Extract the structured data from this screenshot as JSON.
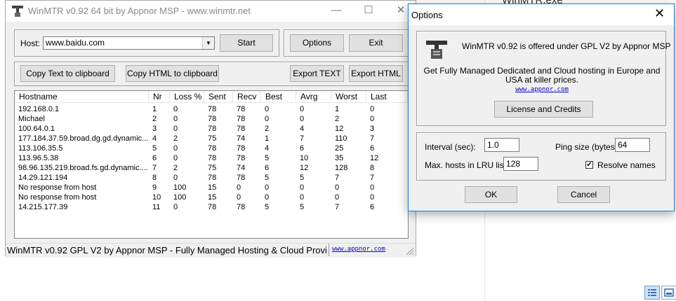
{
  "background_doc": {
    "title": "WinMTR.exe"
  },
  "main_window": {
    "title": "WinMTR v0.92 64 bit by Appnor MSP - www.winmtr.net",
    "controls": {
      "minimize": "—",
      "maximize": "☐",
      "close": "✕"
    },
    "host_label": "Host:",
    "host_value": "www.baidu.com",
    "start_label": "Start",
    "options_label": "Options",
    "exit_label": "Exit",
    "copy_text_label": "Copy Text to clipboard",
    "copy_html_label": "Copy HTML to clipboard",
    "export_text_label": "Export TEXT",
    "export_html_label": "Export HTML",
    "columns": [
      "Hostname",
      "Nr",
      "Loss %",
      "Sent",
      "Recv",
      "Best",
      "Avrg",
      "Worst",
      "Last"
    ],
    "rows": [
      [
        "192.168.0.1",
        "1",
        "0",
        "78",
        "78",
        "0",
        "0",
        "1",
        "0"
      ],
      [
        "Michael",
        "2",
        "0",
        "78",
        "78",
        "0",
        "0",
        "2",
        "0"
      ],
      [
        "100.64.0.1",
        "3",
        "0",
        "78",
        "78",
        "2",
        "4",
        "12",
        "3"
      ],
      [
        "177.184.37.59.broad.dg.gd.dynamic....",
        "4",
        "2",
        "75",
        "74",
        "1",
        "7",
        "110",
        "7"
      ],
      [
        "113.106.35.5",
        "5",
        "0",
        "78",
        "78",
        "4",
        "6",
        "25",
        "6"
      ],
      [
        "113.96.5.38",
        "6",
        "0",
        "78",
        "78",
        "5",
        "10",
        "35",
        "12"
      ],
      [
        "98.96.135.219.broad.fs.gd.dynamic....",
        "7",
        "2",
        "75",
        "74",
        "6",
        "12",
        "128",
        "8"
      ],
      [
        "14.29.121.194",
        "8",
        "0",
        "78",
        "78",
        "5",
        "5",
        "7",
        "7"
      ],
      [
        "No response from host",
        "9",
        "100",
        "15",
        "0",
        "0",
        "0",
        "0",
        "0"
      ],
      [
        "No response from host",
        "10",
        "100",
        "15",
        "0",
        "0",
        "0",
        "0",
        "0"
      ],
      [
        "14.215.177.39",
        "11",
        "0",
        "78",
        "78",
        "5",
        "5",
        "7",
        "6"
      ]
    ],
    "status_text": "WinMTR v0.92 GPL V2 by Appnor MSP - Fully Managed Hosting & Cloud Provi",
    "status_link": "www.appnor.com"
  },
  "options_dialog": {
    "title": "Options",
    "close": "✕",
    "about_line1": "WinMTR v0.92 is offered under GPL V2 by Appnor MSP",
    "about_line2": "Get Fully Managed Dedicated and Cloud hosting in Europe and",
    "about_line3": "USA at killer prices.",
    "about_link": "www.appnor.com",
    "license_label": "License and Credits",
    "interval_label": "Interval (sec):",
    "interval_value": "1.0",
    "ping_size_label": "Ping size (bytes):",
    "ping_size_value": "64",
    "max_hosts_label": "Max. hosts in LRU list:",
    "max_hosts_value": "128",
    "resolve_label": "Resolve names",
    "resolve_checked": true,
    "ok_label": "OK",
    "cancel_label": "Cancel"
  }
}
